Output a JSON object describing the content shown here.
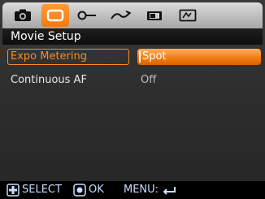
{
  "tabs": [
    {
      "icon": "camera-icon",
      "active": false
    },
    {
      "icon": "movie-icon",
      "active": true
    },
    {
      "icon": "key-icon",
      "active": false
    },
    {
      "icon": "curve-icon",
      "active": false
    },
    {
      "icon": "playback-icon",
      "active": false
    },
    {
      "icon": "settings-card-icon",
      "active": false
    }
  ],
  "title": "Movie Setup",
  "menu": {
    "items": [
      {
        "label": "Expo Metering",
        "value": "Spot",
        "selected": true
      },
      {
        "label": "Continuous AF",
        "value": "Off",
        "selected": false
      }
    ]
  },
  "footer": {
    "select_label": "SELECT",
    "ok_label": "OK",
    "menu_label": "MENU:"
  },
  "colors": {
    "accent": "#f07a10",
    "text": "#ffffff",
    "footer_text": "#c9dcff"
  }
}
